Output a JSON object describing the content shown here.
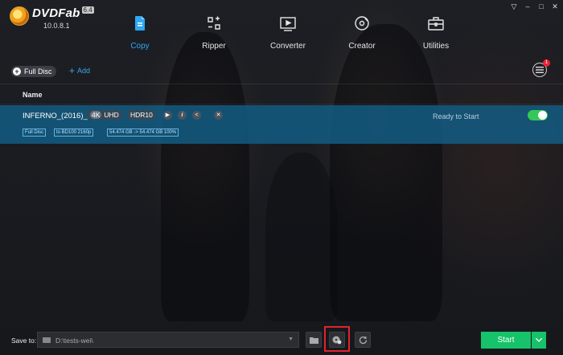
{
  "app": {
    "name": "DVDFab",
    "version_badge": "6.4",
    "build": "10.0.8.1"
  },
  "window_controls": [
    "▽",
    "–",
    "□",
    "✕"
  ],
  "nav": [
    {
      "label": "Copy",
      "icon": "copy-icon",
      "active": true
    },
    {
      "label": "Ripper",
      "icon": "ripper-icon",
      "active": false
    },
    {
      "label": "Converter",
      "icon": "converter-icon",
      "active": false
    },
    {
      "label": "Creator",
      "icon": "creator-icon",
      "active": false
    },
    {
      "label": "Utilities",
      "icon": "utilities-icon",
      "active": false
    }
  ],
  "mode": {
    "label": "Full Disc"
  },
  "add": {
    "label": "Add"
  },
  "task_queue": {
    "badge": "1"
  },
  "list": {
    "column_name": "Name",
    "item": {
      "title": "INFERNO_(2016)_",
      "res_badge": "4K",
      "res_text": "UHD",
      "hdr": "HDR10",
      "status": "Ready to Start",
      "enabled": true,
      "chips": [
        "Full Disc",
        "to BD100 2160p",
        "54.474 GB -> 54.474 GB 100%"
      ]
    }
  },
  "footer": {
    "save_label": "Save to:",
    "path": "D:\\tests-wei\\",
    "start_label": "Start"
  },
  "colors": {
    "accent": "#2fa8f5",
    "row_highlight": "#135c82",
    "start_green": "#16c26a",
    "toggle_green": "#34c759",
    "highlight_box": "#e0242e"
  }
}
